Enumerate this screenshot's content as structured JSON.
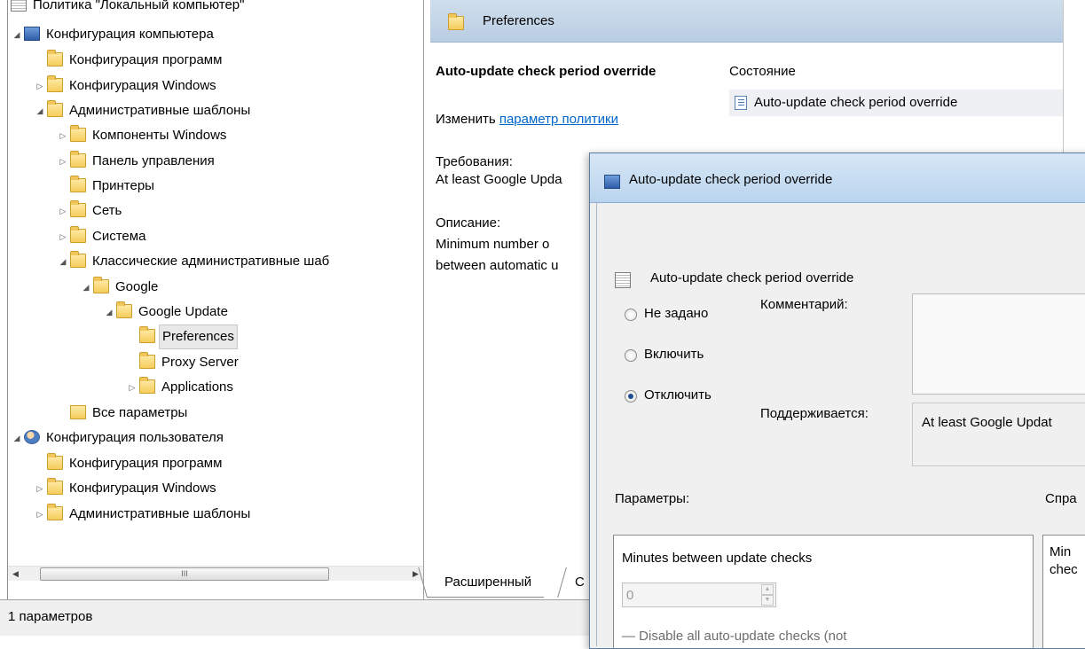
{
  "tree": {
    "items": [
      {
        "label": "Политика \"Локальный компьютер\"",
        "icon": "policy-icon",
        "arrow": ""
      },
      {
        "label": "Конфигурация компьютера",
        "icon": "computer-icon",
        "arrow": "expanded"
      },
      {
        "label": "Конфигурация программ",
        "icon": "folder-icon",
        "arrow": ""
      },
      {
        "label": "Конфигурация Windows",
        "icon": "folder-icon",
        "arrow": "collapsed"
      },
      {
        "label": "Административные шаблоны",
        "icon": "folder-icon",
        "arrow": "expanded"
      },
      {
        "label": "Компоненты Windows",
        "icon": "folder-icon",
        "arrow": "collapsed"
      },
      {
        "label": "Панель управления",
        "icon": "folder-icon",
        "arrow": "collapsed"
      },
      {
        "label": "Принтеры",
        "icon": "folder-icon",
        "arrow": ""
      },
      {
        "label": "Сеть",
        "icon": "folder-icon",
        "arrow": "collapsed"
      },
      {
        "label": "Система",
        "icon": "folder-icon",
        "arrow": "collapsed"
      },
      {
        "label": "Классические административные шаб",
        "icon": "folder-icon",
        "arrow": "expanded"
      },
      {
        "label": "Google",
        "icon": "folder-icon",
        "arrow": "expanded"
      },
      {
        "label": "Google Update",
        "icon": "folder-icon",
        "arrow": "expanded"
      },
      {
        "label": "Preferences",
        "icon": "folder-icon",
        "arrow": "",
        "selected": true
      },
      {
        "label": "Proxy Server",
        "icon": "folder-icon",
        "arrow": ""
      },
      {
        "label": "Applications",
        "icon": "folder-icon",
        "arrow": "collapsed"
      },
      {
        "label": "Все параметры",
        "icon": "all-settings-icon",
        "arrow": ""
      },
      {
        "label": "Конфигурация пользователя",
        "icon": "users-icon",
        "arrow": "expanded"
      },
      {
        "label": "Конфигурация программ",
        "icon": "folder-icon",
        "arrow": ""
      },
      {
        "label": "Конфигурация Windows",
        "icon": "folder-icon",
        "arrow": "collapsed"
      },
      {
        "label": "Административные шаблоны",
        "icon": "folder-icon",
        "arrow": "collapsed"
      }
    ]
  },
  "scrollbar": {
    "thumb_grip": "III",
    "left_arrow": "◀",
    "right_arrow": "▶"
  },
  "status": {
    "text": "1 параметров"
  },
  "right_pane": {
    "header_title": "Preferences",
    "policy_name": "Auto-update check period override",
    "edit_prefix": "Изменить ",
    "edit_link": "параметр политики",
    "requirements_label": "Требования:",
    "requirements_value": "At least Google Upda",
    "description_label": "Описание:",
    "description_line1": "Minimum number o",
    "description_line2": "between automatic u",
    "column_header": "Состояние",
    "list_item": "Auto-update check period override",
    "tab_extended": "Расширенный",
    "tab_standard": "С"
  },
  "dialog": {
    "title": "Auto-update check period override",
    "header": "Auto-update check period override",
    "radio_not_configured": "Не задано",
    "radio_enable": "Включить",
    "radio_disable": "Отключить",
    "selected_radio": "disable",
    "comment_label": "Комментарий:",
    "supported_label": "Поддерживается:",
    "supported_value": "At least Google Updat",
    "options_label": "Параметры:",
    "help_label": "Спра",
    "option_minutes_label": "Minutes between update checks",
    "option_minutes_value": "0",
    "option_disable_checks": "Disable all auto-update checks (not",
    "help_line1": "Min",
    "help_line2": "chec"
  },
  "colors": {
    "link": "#0066cc",
    "header_bg": "#c4d6ea",
    "selection_bg": "#e8e8e8"
  }
}
